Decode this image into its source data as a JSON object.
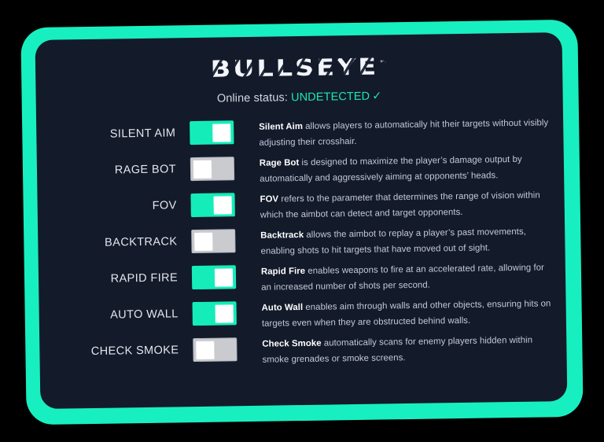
{
  "app": {
    "logo_text": "BULLSEYE",
    "logo_trademark": "™",
    "status_label": "Online status:",
    "status_value": "UNDETECTED",
    "status_check": "✓"
  },
  "colors": {
    "accent": "#14EDB9",
    "panel_bg": "#131A2A",
    "page_bg": "#000000",
    "toggle_off": "#C9CBCF",
    "text": "#E2E6EE"
  },
  "features": [
    {
      "label": "SILENT AIM",
      "state": "on",
      "desc_bold": "Silent Aim",
      "desc_rest": " allows players to automatically hit their targets without visibly adjusting their crosshair."
    },
    {
      "label": "RAGE BOT",
      "state": "off",
      "desc_bold": "Rage Bot",
      "desc_rest": " is designed to maximize the player’s damage output by automatically and aggressively aiming at opponents’ heads."
    },
    {
      "label": "FOV",
      "state": "on",
      "desc_bold": "FOV",
      "desc_rest": " refers to the parameter that determines the range of vision within which the aimbot can detect and target opponents."
    },
    {
      "label": "BACKTRACK",
      "state": "off",
      "desc_bold": "Backtrack",
      "desc_rest": " allows the aimbot to replay a player’s past movements, enabling shots to hit targets that have moved out of sight."
    },
    {
      "label": "RAPID FIRE",
      "state": "on",
      "desc_bold": "Rapid Fire",
      "desc_rest": " enables weapons to fire at an accelerated rate, allowing for an increased number of shots per second."
    },
    {
      "label": "AUTO WALL",
      "state": "on",
      "desc_bold": "Auto Wall",
      "desc_rest": " enables aim through walls and other objects, ensuring hits on targets even when they are obstructed behind walls."
    },
    {
      "label": "CHECK SMOKE",
      "state": "off",
      "desc_bold": "Check Smoke",
      "desc_rest": " automatically scans for enemy players hidden within smoke grenades or smoke screens."
    }
  ]
}
